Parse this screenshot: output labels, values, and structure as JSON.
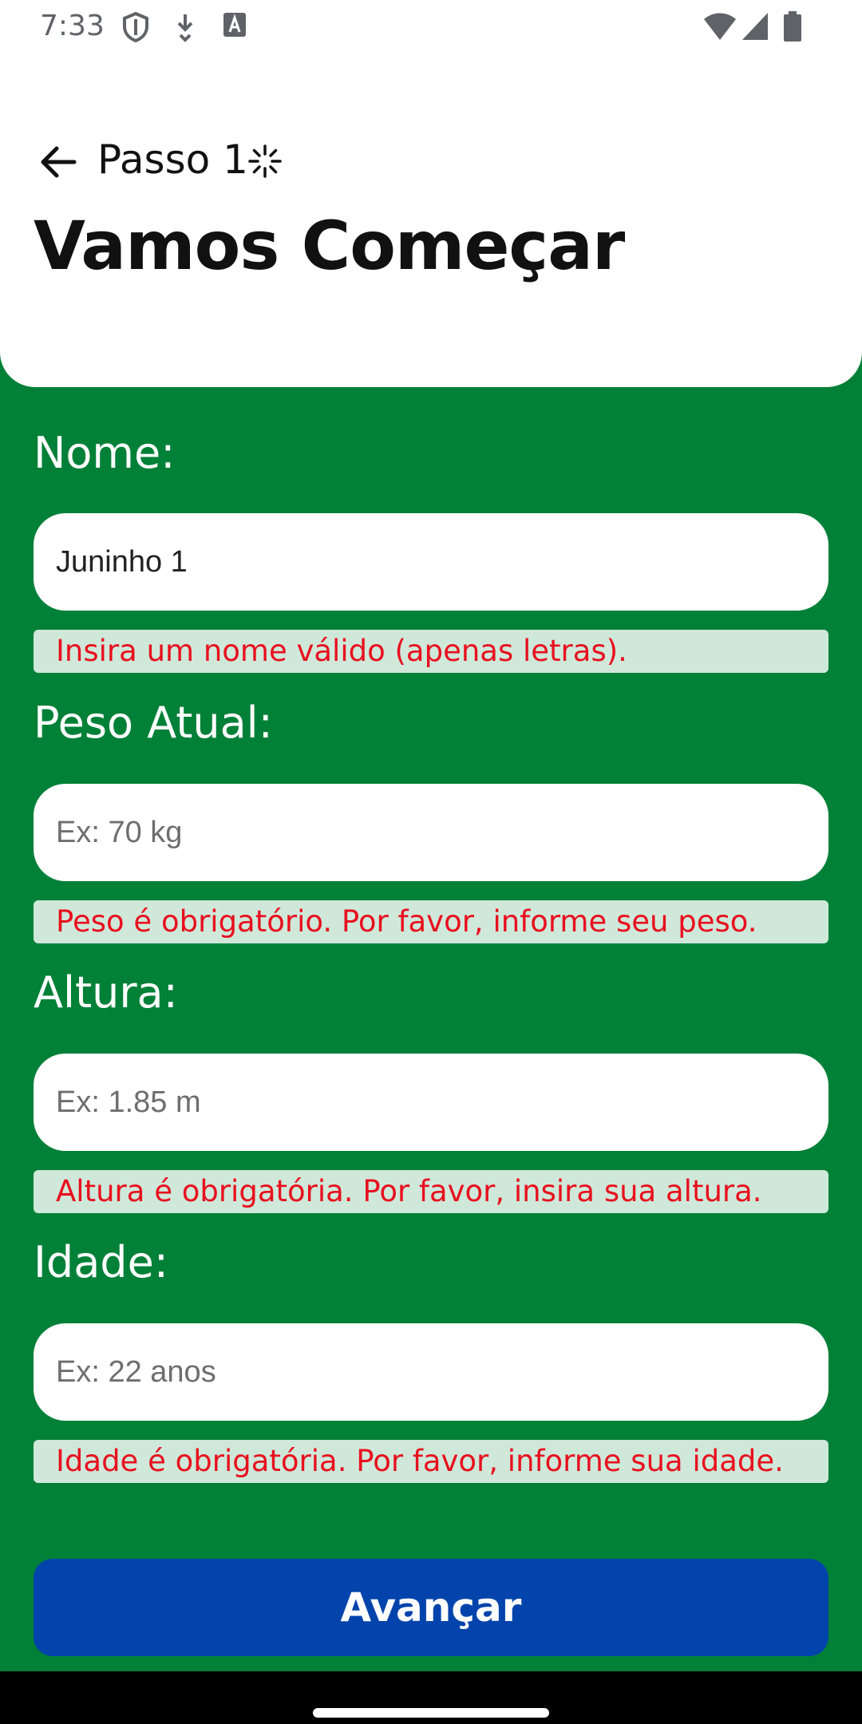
{
  "status_bar": {
    "time": "7:33",
    "icons": [
      "shield-icon",
      "download-icon",
      "font-a-icon",
      "wifi-icon",
      "signal-icon",
      "battery-icon"
    ]
  },
  "header": {
    "step_label": "Passo 1",
    "title": "Vamos Começar"
  },
  "form": {
    "name": {
      "label": "Nome:",
      "value": "Juninho 1",
      "placeholder": "",
      "error": "Insira um nome válido (apenas letras)."
    },
    "weight": {
      "label": "Peso Atual:",
      "value": "",
      "placeholder": "Ex: 70 kg",
      "error": "Peso é obrigatório. Por favor, informe seu peso."
    },
    "height": {
      "label": "Altura:",
      "value": "",
      "placeholder": "Ex: 1.85 m",
      "error": "Altura é obrigatória. Por favor, insira sua altura."
    },
    "age": {
      "label": "Idade:",
      "value": "",
      "placeholder": "Ex: 22 anos",
      "error": "Idade é obrigatória. Por favor, informe sua idade."
    }
  },
  "actions": {
    "advance_label": "Avançar"
  },
  "colors": {
    "background": "#018037",
    "header": "#ffffff",
    "error_text": "#e8101e",
    "error_bg": "#cfe8da",
    "button": "#0244ab"
  }
}
